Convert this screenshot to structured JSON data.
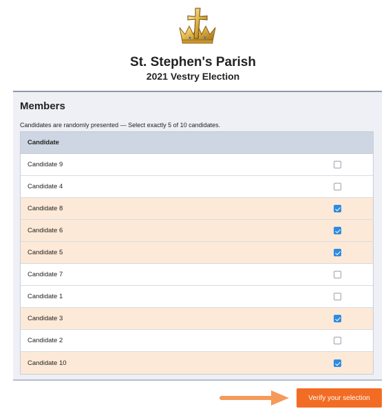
{
  "header": {
    "parish_name": "St. Stephen's Parish",
    "election_name": "2021 Vestry Election",
    "logo_icon": "cross-crown-logo"
  },
  "members": {
    "title": "Members",
    "instructions": "Candidates are randomly presented — Select exactly 5 of 10 candidates.",
    "column_header": "Candidate",
    "candidates": [
      {
        "name": "Candidate 9",
        "selected": false
      },
      {
        "name": "Candidate 4",
        "selected": false
      },
      {
        "name": "Candidate 8",
        "selected": true
      },
      {
        "name": "Candidate 6",
        "selected": true
      },
      {
        "name": "Candidate 5",
        "selected": true
      },
      {
        "name": "Candidate 7",
        "selected": false
      },
      {
        "name": "Candidate 1",
        "selected": false
      },
      {
        "name": "Candidate 3",
        "selected": true
      },
      {
        "name": "Candidate 2",
        "selected": false
      },
      {
        "name": "Candidate 10",
        "selected": true
      }
    ]
  },
  "footer": {
    "verify_label": "Verify your selection",
    "arrow_icon": "right-arrow-icon"
  },
  "colors": {
    "accent": "#f26c23",
    "selected_row": "#fde9d7",
    "checkbox_checked": "#2f8be0",
    "header_row": "#cdd6e2",
    "panel_bg": "#eef0f6"
  }
}
